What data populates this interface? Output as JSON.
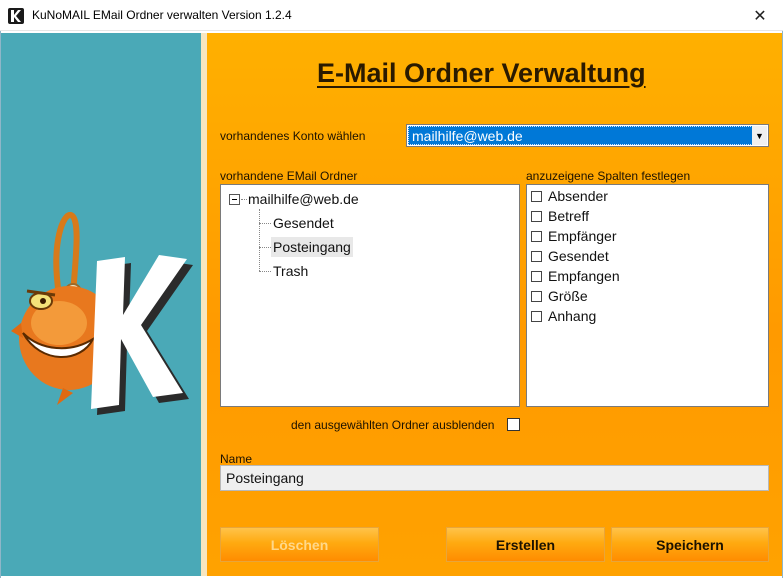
{
  "window": {
    "title": "KuNoMAIL EMail Ordner verwalten Version 1.2.4",
    "close_label": "✕"
  },
  "header": {
    "title": "E-Mail Ordner Verwaltung"
  },
  "account": {
    "label": "vorhandenes Konto wählen",
    "selected": "mailhilfe@web.de",
    "arrow": "▼"
  },
  "folders": {
    "label": "vorhandene EMail Ordner",
    "root": "mailhilfe@web.de",
    "items": [
      "Gesendet",
      "Posteingang",
      "Trash"
    ],
    "selected": "Posteingang"
  },
  "columns": {
    "label": "anzuzeigene Spalten festlegen",
    "items": [
      "Absender",
      "Betreff",
      "Empfänger",
      "Gesendet",
      "Empfangen",
      "Größe",
      "Anhang"
    ]
  },
  "hide_folder": {
    "label": "den ausgewählten Ordner ausblenden",
    "checked": false
  },
  "name": {
    "label": "Name",
    "value": "Posteingang"
  },
  "buttons": {
    "delete": "Löschen",
    "create": "Erstellen",
    "save": "Speichern"
  },
  "colors": {
    "panel_teal": "#4aa9b7",
    "main_orange": "#ffa200",
    "selection_blue": "#0078d7"
  }
}
